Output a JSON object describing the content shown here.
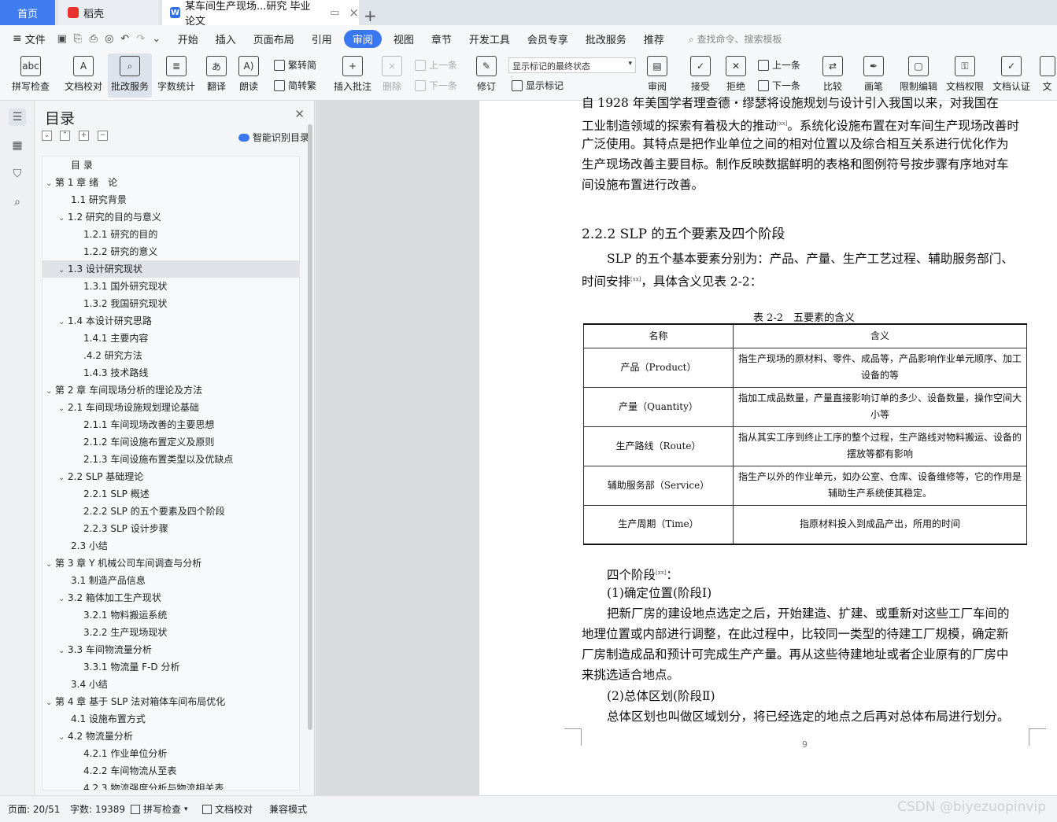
{
  "tabs": {
    "home": "首页",
    "daoke": "稻壳",
    "doc": "某车间生产现场...研究 毕业论文"
  },
  "menu": {
    "file": "文件",
    "items": [
      "开始",
      "插入",
      "页面布局",
      "引用",
      "审阅",
      "视图",
      "章节",
      "开发工具",
      "会员专享",
      "批改服务",
      "推荐"
    ],
    "active_index": 4,
    "search": "查找命令、搜索模板"
  },
  "toolbar": {
    "spell_check": "拼写检查",
    "doc_check": "文档校对",
    "revise_service": "批改服务",
    "word_count": "字数统计",
    "translate": "翻译",
    "read_aloud": "朗读",
    "to_simplified": "繁转简",
    "to_traditional": "简转繁",
    "insert_comment": "插入批注",
    "delete": "删除",
    "prev": "上一条",
    "next": "下一条",
    "track": "修订",
    "markup_state": "显示标记的最终状态",
    "show_markup": "显示标记",
    "review": "审阅",
    "accept": "接受",
    "reject": "拒绝",
    "prev2": "上一条",
    "next2": "下一条",
    "compare": "比较",
    "pen": "画笔",
    "restrict_edit": "限制编辑",
    "doc_rights": "文档权限",
    "doc_cert": "文档认证",
    "doc_cut": "文"
  },
  "nav": {
    "title": "目录",
    "smart_toc": "智能识别目录",
    "highlight_index": 6,
    "items": [
      {
        "label": "目 录",
        "level": 1,
        "arrow": false
      },
      {
        "label": "第 1 章  绪　论",
        "level": 0,
        "arrow": true
      },
      {
        "label": "1.1  研究背景",
        "level": 1,
        "arrow": false
      },
      {
        "label": "1.2  研究的目的与意义",
        "level": 1,
        "arrow": true
      },
      {
        "label": "1.2.1  研究的目的",
        "level": 2,
        "arrow": false
      },
      {
        "label": "1.2.2  研究的意义",
        "level": 2,
        "arrow": false
      },
      {
        "label": "1.3  设计研究现状",
        "level": 1,
        "arrow": true
      },
      {
        "label": "1.3.1  国外研究现状",
        "level": 2,
        "arrow": false
      },
      {
        "label": "1.3.2  我国研究现状",
        "level": 2,
        "arrow": false
      },
      {
        "label": "1.4  本设计研究思路",
        "level": 1,
        "arrow": true
      },
      {
        "label": "1.4.1  主要内容",
        "level": 2,
        "arrow": false
      },
      {
        "label": ".4.2  研究方法",
        "level": 2,
        "arrow": false
      },
      {
        "label": "1.4.3  技术路线",
        "level": 2,
        "arrow": false
      },
      {
        "label": "第 2 章  车间现场分析的理论及方法",
        "level": 0,
        "arrow": true
      },
      {
        "label": "2.1  车间现场设施规划理论基础",
        "level": 1,
        "arrow": true
      },
      {
        "label": "2.1.1  车间现场改善的主要思想",
        "level": 2,
        "arrow": false
      },
      {
        "label": "2.1.2  车间设施布置定义及原则",
        "level": 2,
        "arrow": false
      },
      {
        "label": "2.1.3  车间设施布置类型以及优缺点",
        "level": 2,
        "arrow": false
      },
      {
        "label": "2.2 SLP 基础理论",
        "level": 1,
        "arrow": true
      },
      {
        "label": "2.2.1 SLP 概述",
        "level": 2,
        "arrow": false
      },
      {
        "label": "2.2.2 SLP 的五个要素及四个阶段",
        "level": 2,
        "arrow": false
      },
      {
        "label": "2.2.3 SLP 设计步骤",
        "level": 2,
        "arrow": false
      },
      {
        "label": "2.3  小结",
        "level": 1,
        "arrow": false
      },
      {
        "label": "第 3 章  Y 机械公司车间调查与分析",
        "level": 0,
        "arrow": true
      },
      {
        "label": "3.1  制造产品信息",
        "level": 1,
        "arrow": false
      },
      {
        "label": "3.2  箱体加工生产现状",
        "level": 1,
        "arrow": true
      },
      {
        "label": "3.2.1  物料搬运系统",
        "level": 2,
        "arrow": false
      },
      {
        "label": "3.2.2  生产现场现状",
        "level": 2,
        "arrow": false
      },
      {
        "label": "3.3  车间物流量分析",
        "level": 1,
        "arrow": true
      },
      {
        "label": "3.3.1  物流量 F-D 分析",
        "level": 2,
        "arrow": false
      },
      {
        "label": "3.4  小结",
        "level": 1,
        "arrow": false
      },
      {
        "label": "第 4 章  基于 SLP 法对箱体车间布局优化",
        "level": 0,
        "arrow": true
      },
      {
        "label": "4.1  设施布置方式",
        "level": 1,
        "arrow": false
      },
      {
        "label": "4.2  物流量分析",
        "level": 1,
        "arrow": true
      },
      {
        "label": "4.2.1  作业单位分析",
        "level": 2,
        "arrow": false
      },
      {
        "label": "4.2.2  车间物流从至表",
        "level": 2,
        "arrow": false
      },
      {
        "label": "4.2.3  物流强度分析与物流相关表",
        "level": 2,
        "arrow": false
      }
    ]
  },
  "doc": {
    "p_top": [
      "自 1928 年美国学者理查德・缪瑟将设施规划与设计引入我国以来，对我国在",
      "工业制造领域的探索有着极大的推动",
      "。系统化设施布置在对车间生产现场改善时",
      "广泛使用。其特点是把作业单位之间的相对位置以及综合相互关系进行优化作为",
      "生产现场改善主要目标。制作反映数据鲜明的表格和图例符号按步骤有序地对车",
      "间设施布置进行改善。"
    ],
    "heading": "2.2.2  SLP 的五个要素及四个阶段",
    "p_slp1": "SLP 的五个基本要素分别为：产品、产量、生产工艺过程、辅助服务部门、",
    "p_slp2a": "时间安排",
    "p_slp2b": "，具体含义见表 2-2：",
    "table_caption": "表 2-2　五要素的含义",
    "table_headers": [
      "名称",
      "含义"
    ],
    "table_rows": [
      [
        "产品（Product）",
        "指生产现场的原材料、零件、成品等，产品影响作业单元顺序、加工设备的等"
      ],
      [
        "产量（Quantity）",
        "指加工成品数量，产量直接影响订单的多少、设备数量，操作空间大小等"
      ],
      [
        "生产路线（Route）",
        "指从其实工序到终止工序的整个过程，生产路线对物料搬运、设备的摆放等都有影响"
      ],
      [
        "辅助服务部（Service）",
        "指生产以外的作业单元，如办公室、仓库、设备维修等，它的作用是辅助生产系统使其稳定。"
      ],
      [
        "生产周期（Time）",
        "指原材料投入到成品产出，所用的时间"
      ]
    ],
    "four_stages": "四个阶段",
    "four_stages_colon": "：",
    "stage1": "(1)确定位置(阶段Ⅰ)",
    "p_s1": [
      "把新厂房的建设地点选定之后，开始建造、扩建、或重新对这些工厂车间的",
      "地理位置或内部进行调整，在此过程中，比较同一类型的待建工厂规模，确定新",
      "厂房制造成品和预计可完成生产产量。再从这些待建地址或者企业原有的厂房中",
      "来挑选适合地点。"
    ],
    "stage2": "(2)总体区划(阶段Ⅱ)",
    "p_s2": "总体区划也叫做区域划分，将已经选定的地点之后再对总体布局进行划分。",
    "cite": "[xx]",
    "page_number": "9"
  },
  "status": {
    "page": "页面: 20/51",
    "words": "字数: 19389",
    "spell": "拼写检查",
    "proof": "文档校对",
    "compat": "兼容模式",
    "watermark": "CSDN @biyezuopinvip"
  }
}
